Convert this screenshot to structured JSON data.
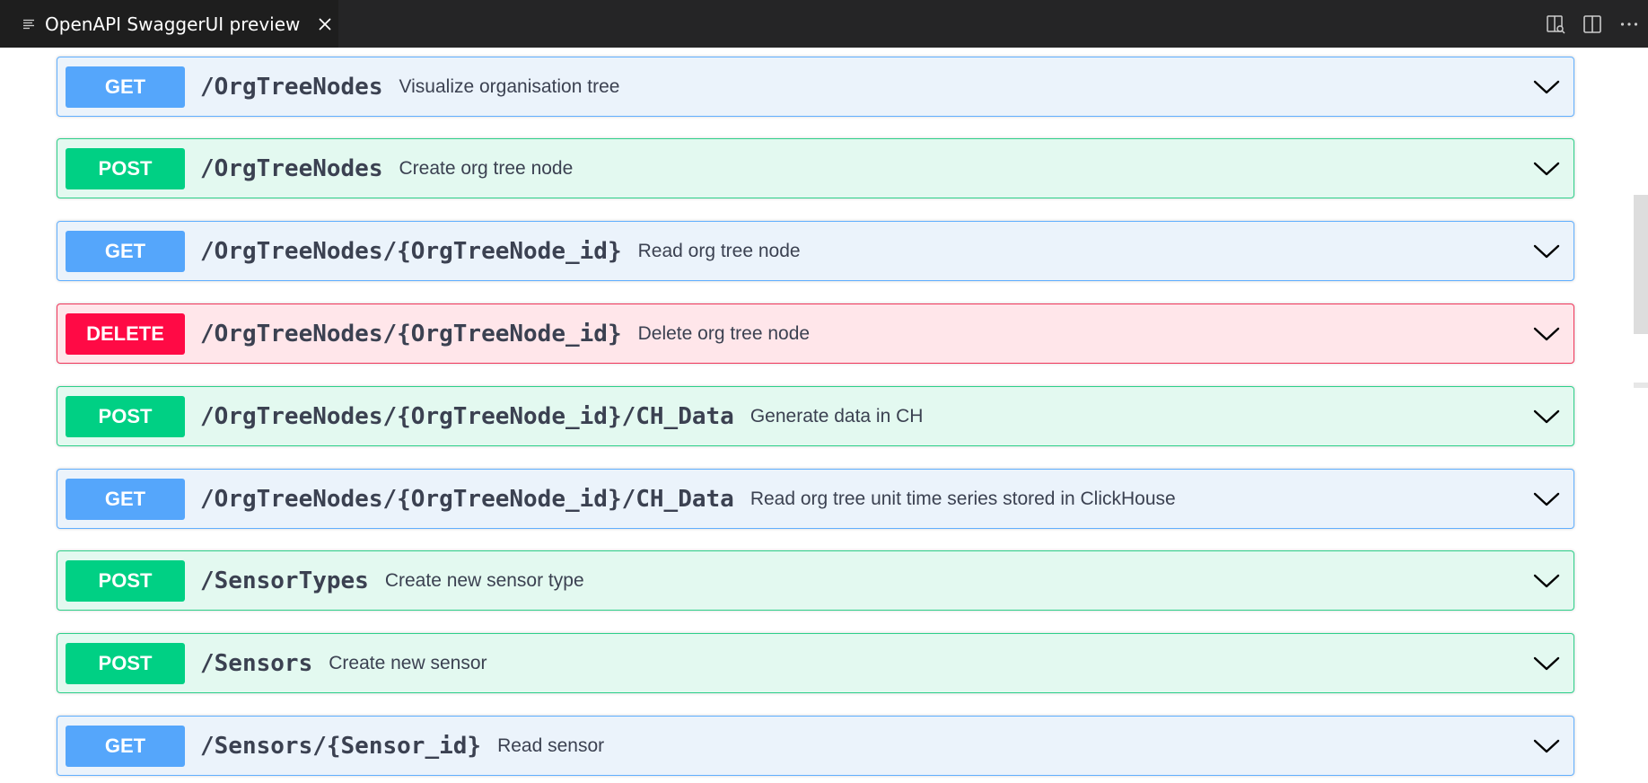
{
  "tab": {
    "title": "OpenAPI SwaggerUI preview",
    "icon": "preview-lines-icon",
    "close_icon": "close-icon"
  },
  "actions": [
    {
      "name": "open-preview-source-icon"
    },
    {
      "name": "split-editor-icon"
    },
    {
      "name": "more-actions-icon"
    }
  ],
  "colors": {
    "get": "#55a6fb",
    "post": "#00d084",
    "delete": "#ff0a45",
    "text": "#3b4151"
  },
  "operations": [
    {
      "method": "GET",
      "path": "/OrgTreeNodes",
      "summary": "Visualize organisation tree"
    },
    {
      "method": "POST",
      "path": "/OrgTreeNodes",
      "summary": "Create org tree node"
    },
    {
      "method": "GET",
      "path": "/OrgTreeNodes/{OrgTreeNode_id}",
      "summary": "Read org tree node"
    },
    {
      "method": "DELETE",
      "path": "/OrgTreeNodes/{OrgTreeNode_id}",
      "summary": "Delete org tree node"
    },
    {
      "method": "POST",
      "path": "/OrgTreeNodes/{OrgTreeNode_id}/CH_Data",
      "summary": "Generate data in CH"
    },
    {
      "method": "GET",
      "path": "/OrgTreeNodes/{OrgTreeNode_id}/CH_Data",
      "summary": "Read org tree unit time series stored in ClickHouse"
    },
    {
      "method": "POST",
      "path": "/SensorTypes",
      "summary": "Create new sensor type"
    },
    {
      "method": "POST",
      "path": "/Sensors",
      "summary": "Create new sensor"
    },
    {
      "method": "GET",
      "path": "/Sensors/{Sensor_id}",
      "summary": "Read sensor"
    }
  ]
}
